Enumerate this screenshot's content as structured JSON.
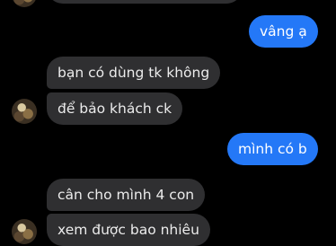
{
  "messages": [
    {
      "direction": "outgoing",
      "text": "vâng ạ"
    },
    {
      "direction": "incoming",
      "text": "bạn có dùng tk không"
    },
    {
      "direction": "incoming",
      "text": "để bảo khách ck"
    },
    {
      "direction": "outgoing",
      "text": "mình có b"
    },
    {
      "direction": "incoming",
      "text": "cân cho mình 4 con"
    },
    {
      "direction": "incoming",
      "text": "xem được bao nhiêu"
    }
  ],
  "colors": {
    "background": "#000000",
    "incoming_bubble": "#2f2f31",
    "outgoing_bubble": "#2478f7"
  }
}
